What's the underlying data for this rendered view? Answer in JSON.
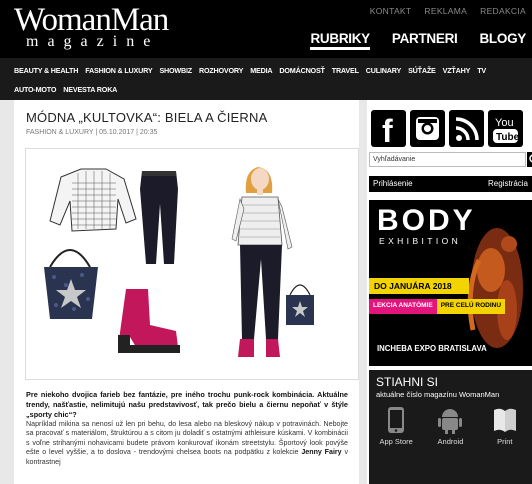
{
  "header": {
    "logo_main": "WomanMan",
    "logo_sub": "magazine",
    "top_links": [
      "KONTAKT",
      "REKLAMA",
      "REDAKCIA"
    ],
    "main_nav": [
      "RUBRIKY",
      "PARTNERI",
      "BLOGY"
    ],
    "active_nav": "RUBRIKY"
  },
  "categories": [
    "BEAUTY & HEALTH",
    "FASHION & LUXURY",
    "SHOWBIZ",
    "ROZHOVORY",
    "MEDIA",
    "DOMÁCNOSŤ",
    "TRAVEL",
    "CULINARY",
    "SÚŤAŽE",
    "VZŤAHY",
    "TV",
    "AUTO-MOTO",
    "NEVESTA ROKA"
  ],
  "article": {
    "title": "MÓDNA „KULTOVKA“: BIELA A ČIERNA",
    "meta": "FASHION & LUXURY | 05.10.2017 | 20:35",
    "lead": "Pre niekoho dvojica farieb bez fantázie, pre iného trochu punk-rock kombinácia. Aktuálne trendy, našťastie, nelimitujú našu predstavivosť, tak prečo bielu a čiernu nepoňať v štýle „sporty chic“?",
    "body_1": "Napríklad mikina sa nenosí už len pri behu, do lesa alebo na bleskový nákup v potravinách. Nebojte sa pracovať s materiálom, štruktúrou a s citom ju doladiť s ostatnými athleisure kúskami. V kombinácii s voľne strihanými nohavicami budete právom konkurovať ikonám streetstylu. Športový look povýše ešte o level vyššie, a to doslova - trendovými chelsea boots na podpätku z kolekcie",
    "body_bold": "Jenny Fairy",
    "body_2": "v kontrastnej"
  },
  "sidebar": {
    "search_placeholder": "Vyhľadávanie",
    "login": "Prihlásenie",
    "register": "Registrácia",
    "ad": {
      "title": "BODY",
      "subtitle": "EXHIBITION",
      "date": "DO JANUÁRA 2018",
      "lecture_1": "LEKCIA ANATÓMIE",
      "lecture_2": "PRE CELÚ RODINU",
      "venue": "INCHEBA EXPO BRATISLAVA"
    },
    "download": {
      "title": "STIAHNI SI",
      "subtitle": "aktuálne číslo magazínu WomanMan",
      "items": [
        "App Store",
        "Android",
        "Print"
      ]
    }
  },
  "social_icons": [
    "facebook-icon",
    "instagram-icon",
    "rss-icon",
    "youtube-icon"
  ],
  "colors": {
    "header_bg": "#000000",
    "ad_yellow": "#f4d400",
    "ad_pink": "#e3157c"
  }
}
